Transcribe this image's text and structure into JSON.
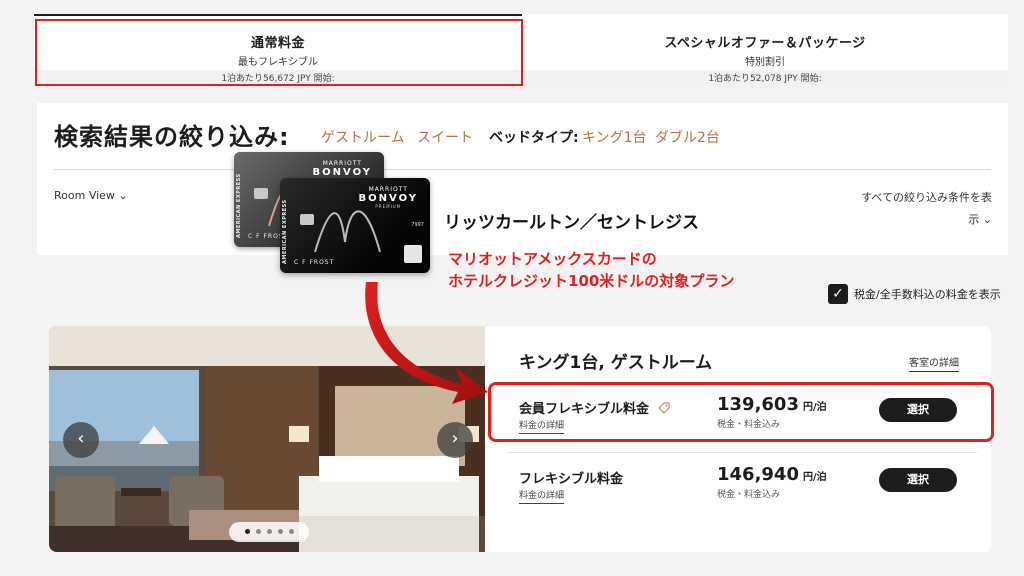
{
  "rate_tabs": [
    {
      "title": "通常料金",
      "subtitle": "最もフレキシブル",
      "price": "1泊あたり56,672 JPY 開始:"
    },
    {
      "title": "スペシャルオファー＆パッケージ",
      "subtitle": "特別割引",
      "price": "1泊あたり52,078 JPY 開始:"
    }
  ],
  "filter": {
    "title": "検索結果の絞り込み:",
    "chips": [
      "ゲストルーム",
      "スイート"
    ],
    "bed_type_label": "ベッドタイプ:",
    "bed_chips": [
      "キング1台",
      "ダブル2台"
    ],
    "room_view": "Room View",
    "all_filters_line1": "すべての絞り込み条件を表",
    "all_filters_line2": "示"
  },
  "overlay": {
    "ritz": "リッツカールトン／セントレジス",
    "promo_line1": "マリオットアメックスカードの",
    "promo_line2": "ホテルクレジット100米ドルの対象プラン",
    "card_brand_small": "MARRIOTT",
    "card_brand": "BONVOY",
    "card_premium": "PREMIUM",
    "card_side": "AMERICAN EXPRESS",
    "card_holder": "C F FROST",
    "card_number": "7997"
  },
  "tax_toggle": {
    "label": "税金/全手数料込の料金を表示",
    "checked": true
  },
  "room": {
    "name": "キング1台, ゲストルーム",
    "detail_link": "客室の詳細",
    "rates": [
      {
        "name": "会員フレキシブル料金",
        "detail": "料金の詳細",
        "amount": "139,603",
        "unit": "円/泊",
        "tax": "税金・料金込み",
        "button": "選択"
      },
      {
        "name": "フレキシブル料金",
        "detail": "料金の詳細",
        "amount": "146,940",
        "unit": "円/泊",
        "tax": "税金・料金込み",
        "button": "選択"
      }
    ]
  },
  "colors": {
    "accent": "#b87044",
    "highlight": "#e0201f",
    "dark": "#1c1c1c"
  }
}
